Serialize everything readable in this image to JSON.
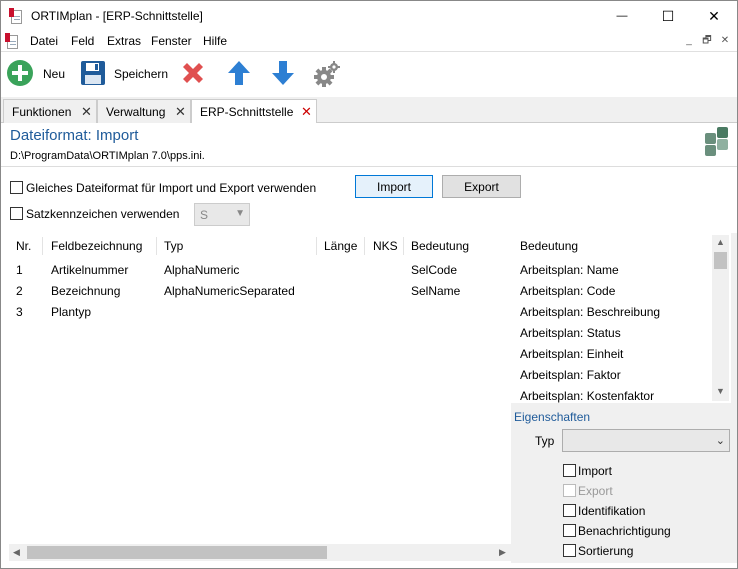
{
  "window": {
    "title": "ORTIMplan - [ERP-Schnittstelle]",
    "controls": {
      "minimize": "—",
      "maximize": "☐",
      "close": "✕"
    }
  },
  "menu": {
    "items": [
      "Datei",
      "Feld",
      "Extras",
      "Fenster",
      "Hilfe"
    ],
    "mdi_controls": [
      "_",
      "🗗",
      "✕"
    ]
  },
  "toolbar": {
    "new_label": "Neu",
    "save_label": "Speichern"
  },
  "tabs": [
    {
      "label": "Funktionen",
      "close": "✕"
    },
    {
      "label": "Verwaltung",
      "close": "✕"
    },
    {
      "label": "ERP-Schnittstelle",
      "close": "✕"
    }
  ],
  "header": {
    "title": "Dateiformat: Import",
    "path": "D:\\ProgramData\\ORTIMplan 7.0\\pps.ini."
  },
  "options": {
    "same_format_label": "Gleiches Dateiformat für Import und Export verwenden",
    "record_id_label": "Satzkennzeichen verwenden",
    "record_id_value": "S",
    "import_button": "Import",
    "export_button": "Export"
  },
  "grid": {
    "columns": [
      "Nr.",
      "Feldbezeichnung",
      "Typ",
      "Länge",
      "NKS",
      "Bedeutung"
    ],
    "rows": [
      {
        "nr": "1",
        "feld": "Artikelnummer",
        "typ": "AlphaNumeric",
        "laenge": "",
        "nks": "",
        "bedeutung": "SelCode"
      },
      {
        "nr": "2",
        "feld": "Bezeichnung",
        "typ": "AlphaNumericSeparated",
        "laenge": "",
        "nks": "",
        "bedeutung": "SelName"
      },
      {
        "nr": "3",
        "feld": "Plantyp",
        "typ": "",
        "laenge": "",
        "nks": "",
        "bedeutung": ""
      }
    ]
  },
  "meaning_list": {
    "header": "Bedeutung",
    "items": [
      "Arbeitsplan: Name",
      "Arbeitsplan: Code",
      "Arbeitsplan: Beschreibung",
      "Arbeitsplan: Status",
      "Arbeitsplan: Einheit",
      "Arbeitsplan: Faktor",
      "Arbeitsplan: Kostenfaktor"
    ]
  },
  "properties": {
    "section_label": "Eigenschaften",
    "typ_label": "Typ",
    "typ_value": "",
    "checkboxes": [
      {
        "label": "Import",
        "enabled": true
      },
      {
        "label": "Export",
        "enabled": false
      },
      {
        "label": "Identifikation",
        "enabled": true
      },
      {
        "label": "Benachrichtigung",
        "enabled": true
      },
      {
        "label": "Sortierung",
        "enabled": true
      }
    ]
  },
  "colors": {
    "accent": "#1f5b9a",
    "add_green": "#3aa35a",
    "save_blue": "#1f5b9a",
    "delete_red": "#e05050",
    "arrow_blue": "#2d7fd3"
  }
}
